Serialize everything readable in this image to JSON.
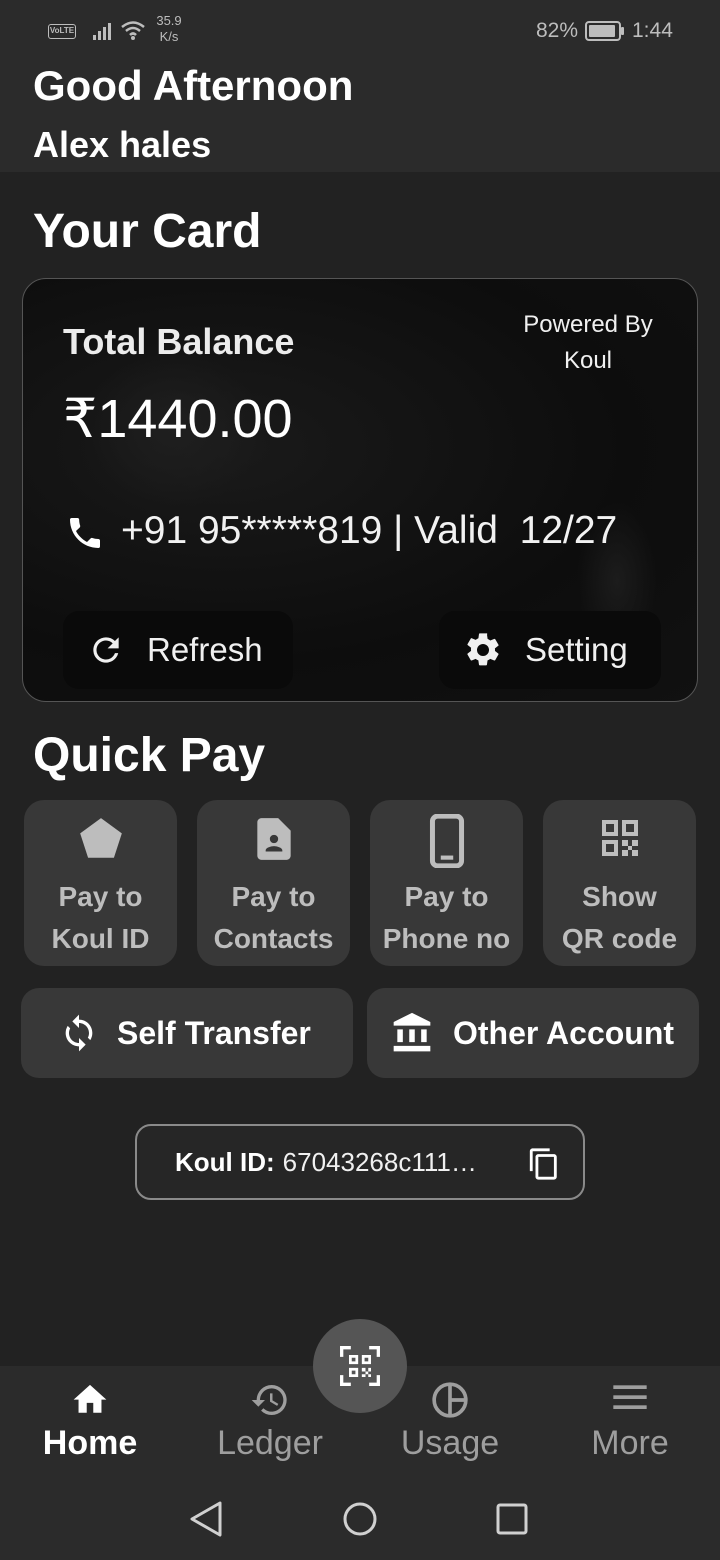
{
  "status_bar": {
    "volte": "VoLTE",
    "speed_value": "35.9",
    "speed_unit": "K/s",
    "battery_percent": "82%",
    "time": "1:44"
  },
  "header": {
    "greeting": "Good Afternoon",
    "user_name": "Alex hales"
  },
  "card_section": {
    "title": "Your Card",
    "total_balance_label": "Total Balance",
    "powered_by_line1": "Powered By",
    "powered_by_line2": "Koul",
    "balance": "₹1440.00",
    "info_line": "+91 95*****819 | Valid  12/27",
    "refresh_label": "Refresh",
    "setting_label": "Setting"
  },
  "quick_pay": {
    "title": "Quick Pay",
    "tiles": [
      {
        "line1": "Pay to",
        "line2": "Koul ID",
        "icon": "pentagon-icon"
      },
      {
        "line1": "Pay to",
        "line2": "Contacts",
        "icon": "contact-card-icon"
      },
      {
        "line1": "Pay to",
        "line2": "Phone no",
        "icon": "smartphone-icon"
      },
      {
        "line1": "Show",
        "line2": "QR code",
        "icon": "qr-code-icon"
      }
    ],
    "self_transfer_label": "Self Transfer",
    "other_account_label": "Other Account"
  },
  "koul_id": {
    "label": "Koul ID:",
    "value": "67043268c111…"
  },
  "bottom_nav": {
    "items": [
      {
        "label": "Home",
        "icon": "home-icon",
        "active": true
      },
      {
        "label": "Ledger",
        "icon": "history-icon",
        "active": false
      },
      {
        "label": "Usage",
        "icon": "pie-chart-icon",
        "active": false
      },
      {
        "label": "More",
        "icon": "menu-icon",
        "active": false
      }
    ]
  },
  "colors": {
    "background": "#222222",
    "header": "#2b2b2b",
    "card": "#0d0d0d",
    "tile": "#383838",
    "fab": "#555555"
  }
}
